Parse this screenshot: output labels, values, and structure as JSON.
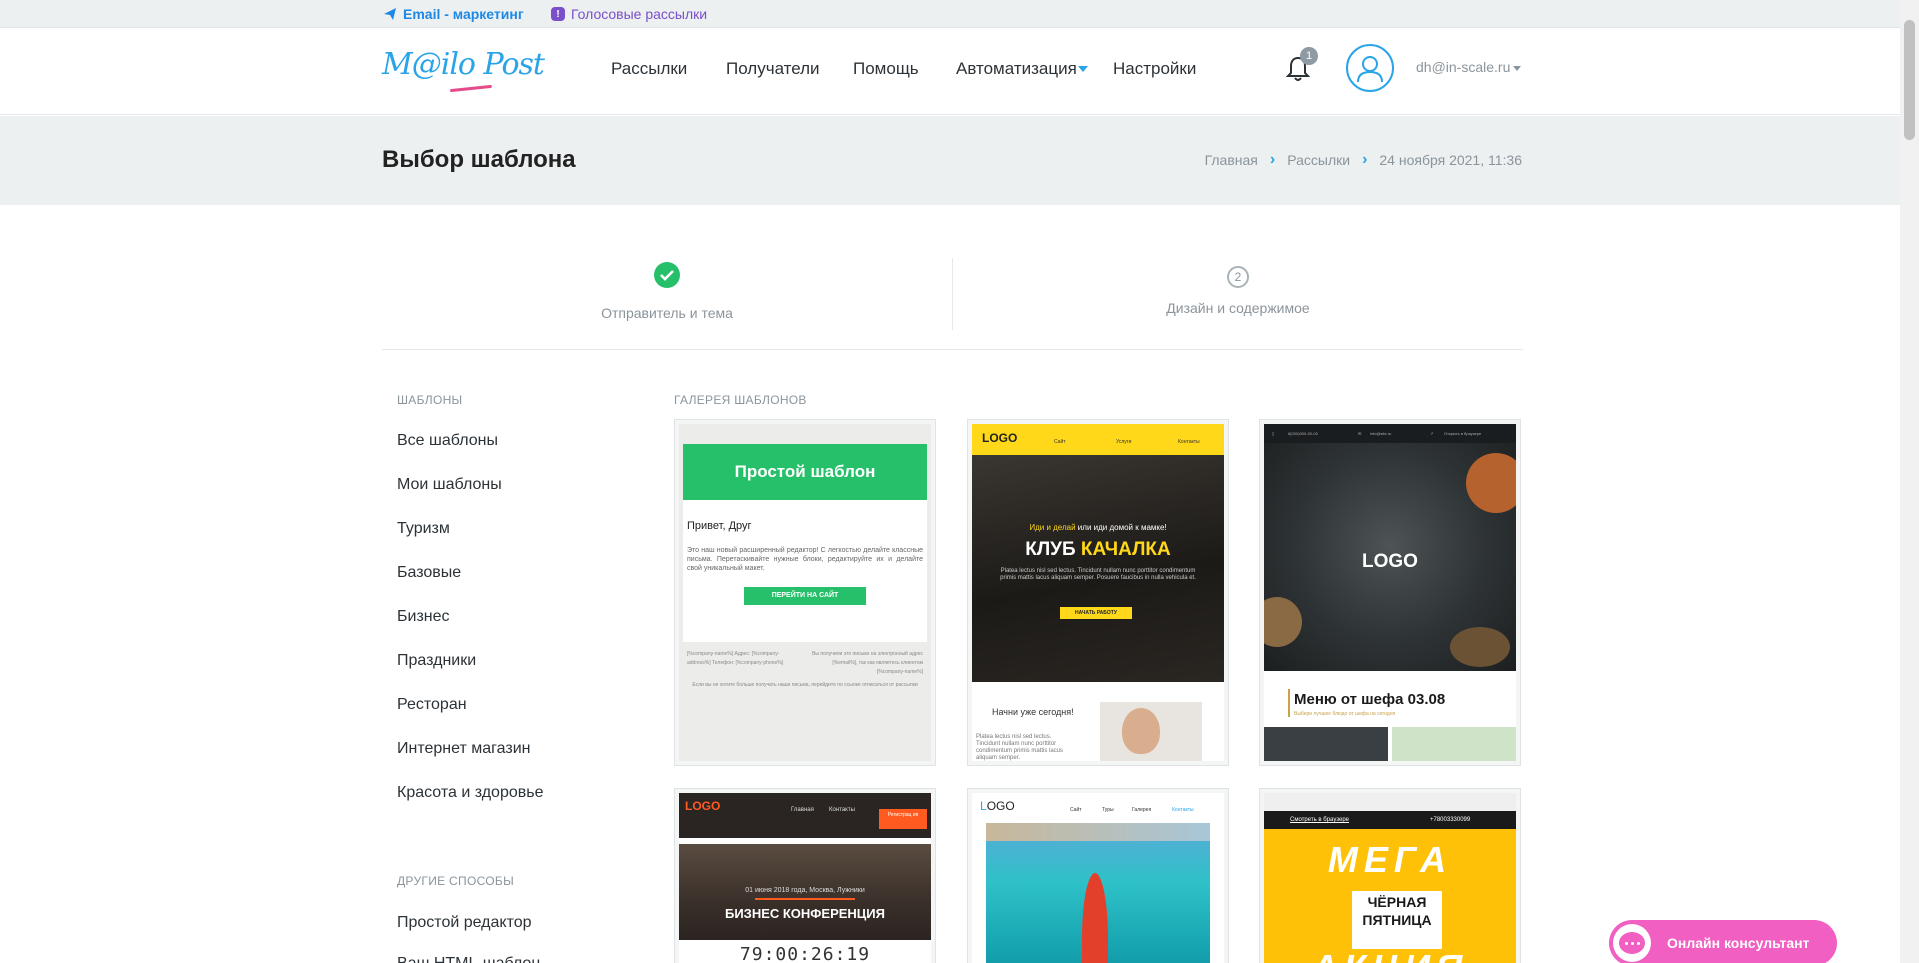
{
  "topbar": {
    "email_label": "Email - маркетинг",
    "voice_label": "Голосовые рассылки"
  },
  "header": {
    "logo": "M@ilo Post",
    "nav": [
      "Рассылки",
      "Получатели",
      "Помощь",
      "Автоматизация",
      "Настройки"
    ],
    "notification_count": "1",
    "user_email": "dh@in-scale.ru"
  },
  "title_band": {
    "title": "Выбор шаблона",
    "breadcrumbs": [
      "Главная",
      "Рассылки",
      "24 ноября 2021, 11:36"
    ]
  },
  "steps": [
    {
      "label": "Отправитель и тема",
      "status": "done"
    },
    {
      "label": "Дизайн и содержимое",
      "number": "2"
    }
  ],
  "sidebar": {
    "templates_heading": "ШАБЛОНЫ",
    "templates": [
      "Все шаблоны",
      "Мои шаблоны",
      "Туризм",
      "Базовые",
      "Бизнес",
      "Праздники",
      "Ресторан",
      "Интернет магазин",
      "Красота и здоровье"
    ],
    "other_heading": "ДРУГИЕ СПОСОБЫ",
    "other": [
      "Простой редактор",
      "Ваш HTML-шаблон"
    ]
  },
  "gallery": {
    "heading": "ГАЛЕРЕЯ ШАБЛОНОВ",
    "simple": {
      "header": "Простой шаблон",
      "greeting": "Привет, Друг",
      "text": "Это наш новый расширенный редактор! С легкостью делайте классные письма. Перетаскивайте нужные блоки, редактируйте их и делайте свой уникальный макет.",
      "button": "ПЕРЕЙТИ НА САЙТ",
      "footer_left": "[%company-name%] Адрес: [%company-address%] Телефон: [%company-phone%]",
      "footer_right": "Вы получили это письмо на электронный адрес [%email%], так как являетесь клиентом [%company-name%]",
      "footer_bottom": "Если вы не хотите больше получать наши письма, перейдите по ссылке отписаться от рассылки"
    },
    "gym": {
      "logo": "LOGO",
      "nav": [
        "Сайт",
        "Услуги",
        "Контакты"
      ],
      "tagline_highlight": "Иди и делай",
      "tagline_rest": " или иди домой к мамке!",
      "title_white": "КЛУБ ",
      "title_yellow": "КАЧАЛКА",
      "text": "Platea lectus nisl sed lectus. Tincidunt nullam nunc porttitor condimentum primis mattis lacus aliquam semper. Posuere faucibus in nulla vehicula et.",
      "button": "НАЧАТЬ РАБОТУ",
      "lower_heading": "Начни уже сегодня!",
      "lower_text": "Platea lectus nisl sed lectus. Tincidunt nullam nunc porttitor condimentum primis mattis lacus aliquam semper."
    },
    "restaurant": {
      "phone": "8(000)000-00-00",
      "email": "info@site.ru",
      "browser": "Открыть в браузере",
      "logo": "LOGO",
      "menu_title": "Меню от шефа 03.08",
      "menu_sub": "Выбери лучшее блюдо от шефа на сегодня"
    },
    "conference": {
      "logo": "LOGO",
      "nav": [
        "Главная",
        "Контакты"
      ],
      "register": "Регистрац ия",
      "date": "01 июня 2018 года, Москва, Лужники",
      "title": "БИЗНЕС КОНФЕРЕНЦИЯ",
      "timer": "79:00:26:19"
    },
    "travel": {
      "logo_first": "L",
      "logo_rest": "OGO",
      "nav": [
        "Сайт",
        "Туры",
        "Галерея",
        "Контакты"
      ]
    },
    "friday": {
      "browser": "Смотреть в браузере",
      "phone": "+78003330099",
      "mega": "МЕГА",
      "black": "ЧЁРНАЯ",
      "friday": "ПЯТНИЦА",
      "action": "АКЦИЯ"
    }
  },
  "consultant": {
    "label": "Онлайн консультант"
  },
  "colors": {
    "accent": "#2aa4e8",
    "green": "#27c06a",
    "yellow": "#ffd81a",
    "pink": "#f05fc1"
  }
}
